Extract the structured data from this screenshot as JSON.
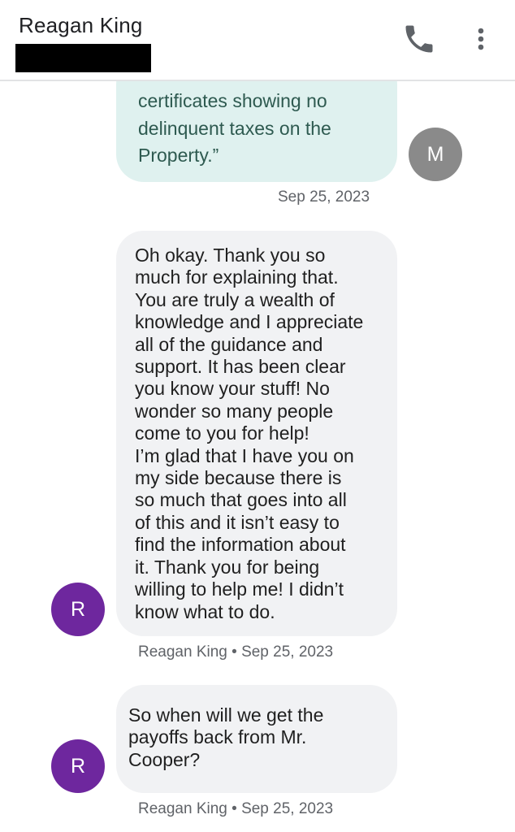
{
  "header": {
    "contact_name": "Reagan King",
    "call_icon": "phone-icon",
    "menu_icon": "more-vert-icon"
  },
  "messages": [
    {
      "direction": "outgoing",
      "text": "certificates showing no\ndelinquent taxes on the\nProperty.”",
      "avatar_initial": "M",
      "meta": "Sep 25, 2023"
    },
    {
      "direction": "incoming",
      "text": "Oh okay. Thank you so\nmuch for explaining that.\nYou are truly a wealth of\nknowledge and I appreciate\nall of the guidance and\nsupport. It has been clear\nyou know your stuff! No\nwonder so many people\ncome to you for help!\nI’m glad that I have you on\nmy side because there is\nso much that goes into all\nof this and it isn’t easy to\nfind the information about\nit. Thank you for being\nwilling to help me! I didn’t\nknow what to do.",
      "avatar_initial": "R",
      "meta": "Reagan King • Sep 25, 2023"
    },
    {
      "direction": "incoming",
      "text": "So when will we get the\npayoffs back from Mr.\nCooper?",
      "avatar_initial": "R",
      "meta": "Reagan King • Sep 25, 2023"
    }
  ],
  "colors": {
    "outgoing_bubble": "#dff1ef",
    "incoming_bubble": "#f1f2f4",
    "avatar_self": "#8a8a8a",
    "avatar_contact": "#6e279e"
  }
}
